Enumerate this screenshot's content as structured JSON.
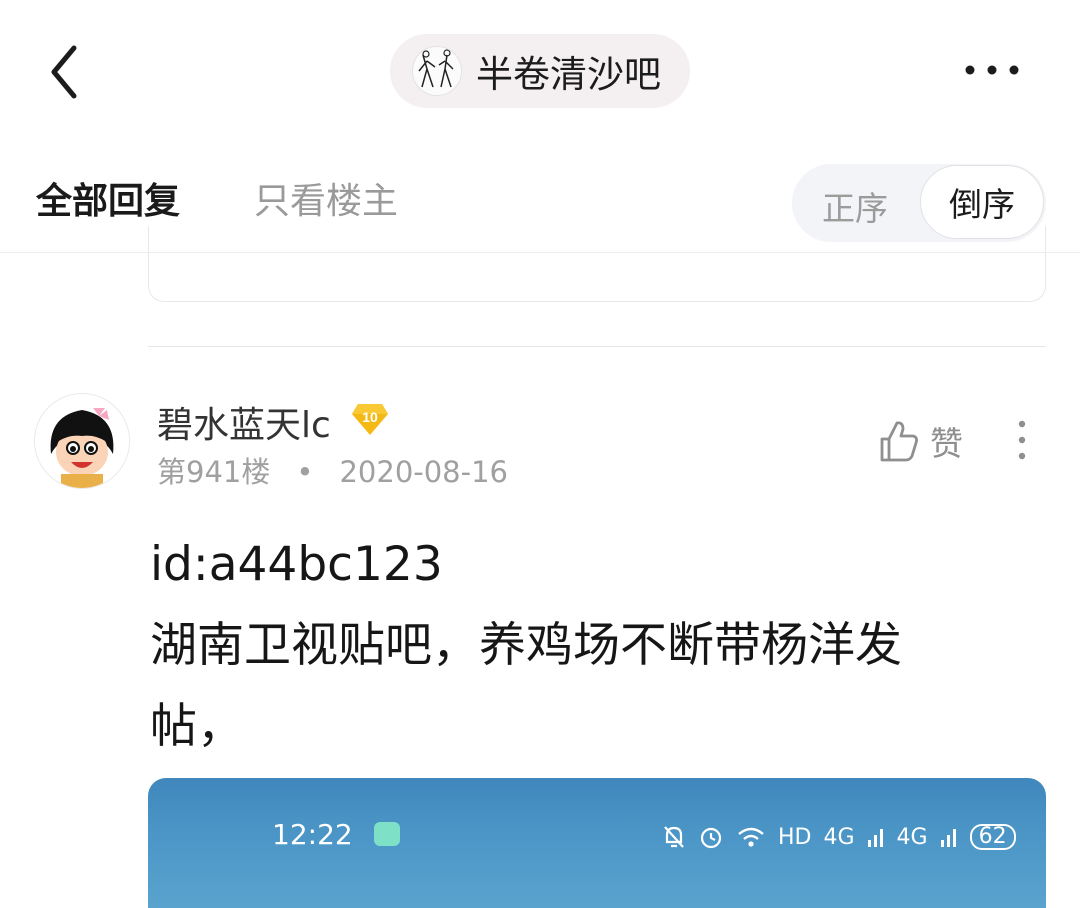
{
  "nav": {
    "forum_name": "半卷清沙吧",
    "back_icon": "chevron-left-icon",
    "more_icon": "more-horizontal-icon"
  },
  "filters": {
    "all_replies": "全部回复",
    "op_only": "只看楼主",
    "sort_asc": "正序",
    "sort_desc": "倒序",
    "selected_sort": "倒序"
  },
  "post": {
    "username": "碧水蓝天lc",
    "level": "10",
    "floor": "第941楼",
    "separator": "•",
    "date": "2020-08-16",
    "like_label": "赞",
    "body": "id:a44bc123\n湖南卫视贴吧，养鸡场不断带杨洋发\n帖，",
    "image": {
      "time": "12:22",
      "status_hd": "HD",
      "signal_1": "4G",
      "signal_2": "4G",
      "battery": "62"
    }
  },
  "colors": {
    "accent_pill": "#f4eff1",
    "sort_bg": "#f3f4f8",
    "level_badge": "#f5b915",
    "image_blue": "#4a95c6"
  }
}
